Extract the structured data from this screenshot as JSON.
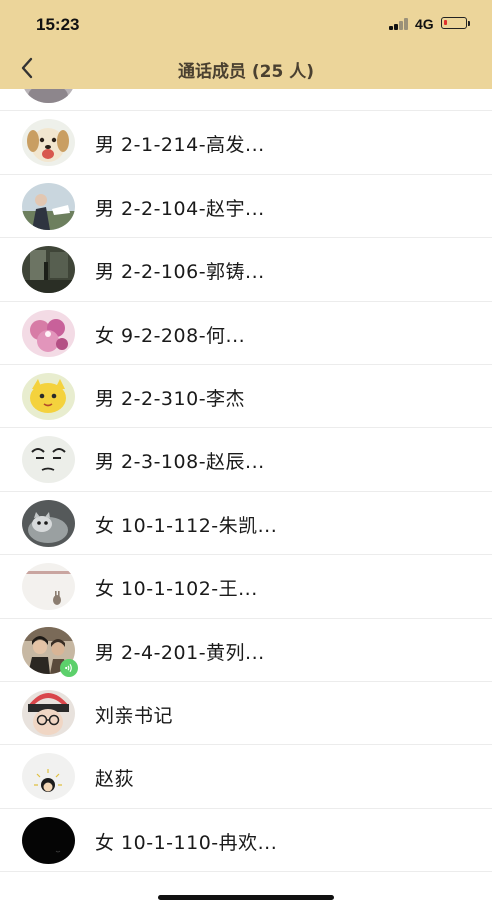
{
  "status_bar": {
    "time": "15:23",
    "network": "4G"
  },
  "nav": {
    "title": "通话成员 (25 人)"
  },
  "members": [
    {
      "name": "",
      "avatar": "grey-face-avatar-icon",
      "speaking": false
    },
    {
      "name": "男 2-1-214-高发...",
      "avatar": "puppy-avatar-icon",
      "speaking": false
    },
    {
      "name": "男 2-2-104-赵宇...",
      "avatar": "person-outdoor-avatar-icon",
      "speaking": false
    },
    {
      "name": "男 2-2-106-郭铸...",
      "avatar": "dark-room-avatar-icon",
      "speaking": false
    },
    {
      "name": "女 9-2-208-何...",
      "avatar": "pink-flower-avatar-icon",
      "speaking": false
    },
    {
      "name": "男 2-2-310-李杰",
      "avatar": "yellow-cartoon-avatar-icon",
      "speaking": false
    },
    {
      "name": "男 2-3-108-赵辰...",
      "avatar": "sketch-face-avatar-icon",
      "speaking": false
    },
    {
      "name": "女 10-1-112-朱凯...",
      "avatar": "cat-avatar-icon",
      "speaking": false
    },
    {
      "name": "女 10-1-102-王...",
      "avatar": "rabbit-avatar-icon",
      "speaking": false
    },
    {
      "name": "男 2-4-201-黄列...",
      "avatar": "couple-photo-avatar-icon",
      "speaking": true
    },
    {
      "name": "刘亲书记",
      "avatar": "child-glasses-avatar-icon",
      "speaking": false
    },
    {
      "name": "赵荻",
      "avatar": "cartoon-sun-avatar-icon",
      "speaking": false
    },
    {
      "name": "女 10-1-110-冉欢...",
      "avatar": "black-circle-avatar-icon",
      "speaking": false
    }
  ]
}
